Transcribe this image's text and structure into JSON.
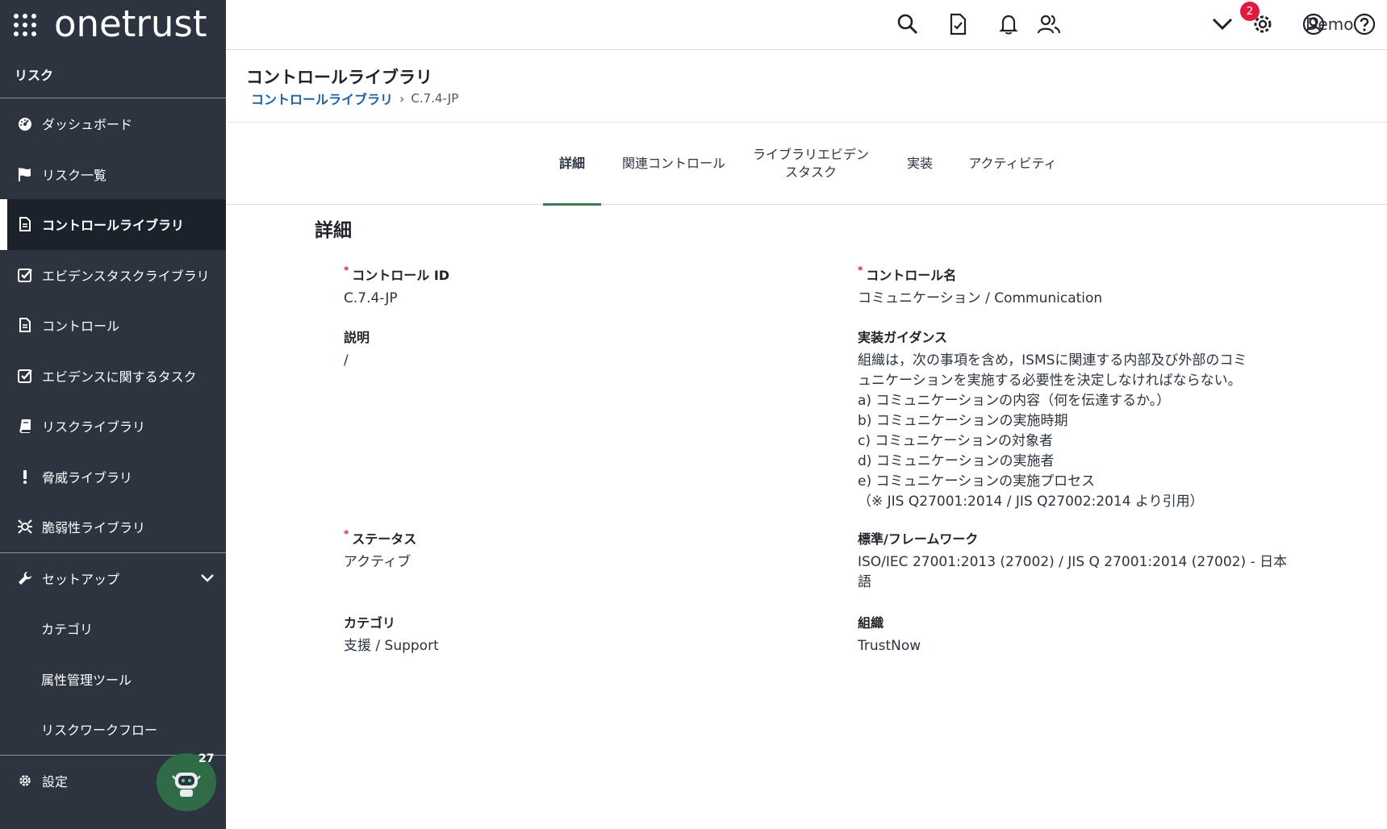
{
  "brand": {
    "name": "onetrust"
  },
  "sidebar": {
    "module": "リスク",
    "items": [
      {
        "label": "ダッシュボード",
        "icon": "dashboard-icon"
      },
      {
        "label": "リスク一覧",
        "icon": "flag-icon"
      },
      {
        "label": "コントロールライブラリ",
        "icon": "document-icon"
      },
      {
        "label": "エビデンスタスクライブラリ",
        "icon": "checkbox-icon"
      },
      {
        "label": "コントロール",
        "icon": "document-icon"
      },
      {
        "label": "エビデンスに関するタスク",
        "icon": "checkbox-icon"
      },
      {
        "label": "リスクライブラリ",
        "icon": "book-icon"
      },
      {
        "label": "脅威ライブラリ",
        "icon": "exclamation-icon"
      },
      {
        "label": "脆弱性ライブラリ",
        "icon": "bug-icon"
      }
    ],
    "setup": {
      "label": "セットアップ",
      "children": [
        "カテゴリ",
        "属性管理ツール",
        "リスクワークフロー"
      ]
    },
    "settings": "設定",
    "assistant_badge": "27"
  },
  "topbar": {
    "notifications_count": "2",
    "user": "Demo"
  },
  "header": {
    "title": "コントロールライブラリ",
    "breadcrumb_link": "コントロールライブラリ",
    "breadcrumb_sep": "›",
    "breadcrumb_current": "C.7.4-JP"
  },
  "tabs": [
    {
      "label": "詳細"
    },
    {
      "label": "関連コントロール"
    },
    {
      "label": "ライブラリエビデン\nスタスク"
    },
    {
      "label": "実装"
    },
    {
      "label": "アクティビティ"
    }
  ],
  "details": {
    "section_title": "詳細",
    "control_id": {
      "label": "コントロール ID",
      "value": "C.7.4-JP"
    },
    "control_name": {
      "label": "コントロール名",
      "value": "コミュニケーション / Communication"
    },
    "description": {
      "label": "説明",
      "value": "/"
    },
    "guidance": {
      "label": "実装ガイダンス",
      "value": "組織は，次の事項を含め，ISMSに関連する内部及び外部のコミ\nュニケーションを実施する必要性を決定しなければならない。\na) コミュニケーションの内容（何を伝達するか。）\nb) コミュニケーションの実施時期\nc) コミュニケーションの対象者\nd) コミュニケーションの実施者\ne) コミュニケーションの実施プロセス\n（※ JIS Q27001:2014 / JIS Q27002:2014 より引用）"
    },
    "status": {
      "label": "ステータス",
      "value": "アクティブ"
    },
    "framework": {
      "label": "標準/フレームワーク",
      "value": "ISO/IEC 27001:2013 (27002) / JIS Q 27001:2014 (27002) - 日本\n語"
    },
    "category": {
      "label": "カテゴリ",
      "value": "支援 / Support"
    },
    "organization": {
      "label": "組織",
      "value": "TrustNow"
    }
  }
}
